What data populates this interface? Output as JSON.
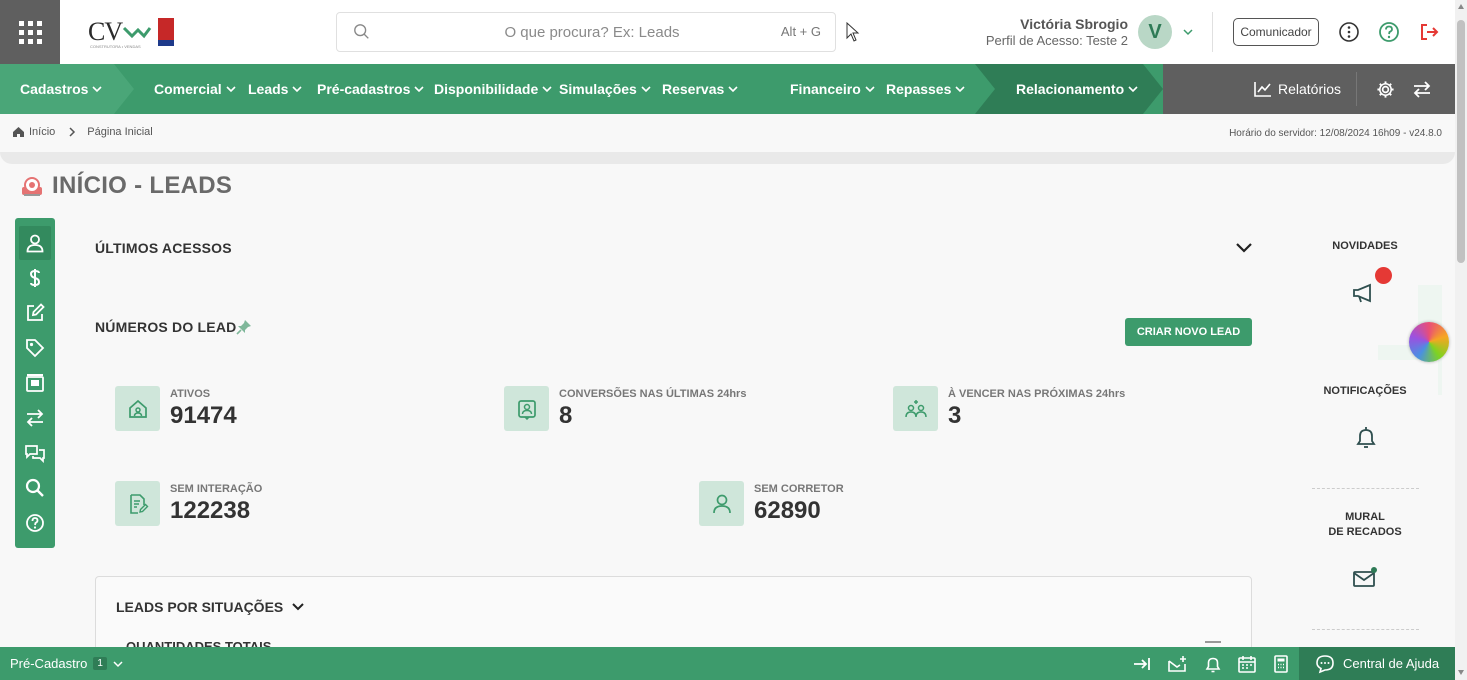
{
  "header": {
    "apps_icon": "apps-grid-icon",
    "logo_text": "CV",
    "logo_subtext": "CONSTRUTORA • VENDAS",
    "search_placeholder": "O que procura? Ex: Leads",
    "search_shortcut": "Alt + G",
    "user_name": "Victória Sbrogio",
    "user_profile": "Perfil de Acesso: Teste 2",
    "avatar_letter": "V",
    "comunicador_label": "Comunicador"
  },
  "nav": {
    "items": [
      {
        "label": "Cadastros"
      },
      {
        "label": "Comercial"
      },
      {
        "label": "Leads"
      },
      {
        "label": "Pré-cadastros"
      },
      {
        "label": "Disponibilidade"
      },
      {
        "label": "Simulações"
      },
      {
        "label": "Reservas"
      },
      {
        "label": "Financeiro"
      },
      {
        "label": "Repasses"
      },
      {
        "label": "Relacionamento"
      }
    ],
    "reports_label": "Relatórios"
  },
  "breadcrumb": {
    "home": "Início",
    "current": "Página Inicial"
  },
  "server_time": "Horário do servidor: 12/08/2024 16h09 - v24.8.0",
  "page_title": "INÍCIO - LEADS",
  "sections": {
    "ultimos_acessos": "ÚLTIMOS ACESSOS",
    "numeros_lead": "NÚMEROS DO LEAD",
    "criar_novo_lead": "CRIAR NOVO LEAD"
  },
  "stats": [
    {
      "label": "ATIVOS",
      "value": "91474",
      "icon": "house-icon"
    },
    {
      "label": "CONVERSÕES NAS ÚLTIMAS 24hrs",
      "value": "8",
      "icon": "contact-icon"
    },
    {
      "label": "À VENCER NAS PRÓXIMAS 24hrs",
      "value": "3",
      "icon": "group-icon"
    },
    {
      "label": "SEM INTERAÇÃO",
      "value": "122238",
      "icon": "document-edit-icon"
    },
    {
      "label": "SEM CORRETOR",
      "value": "62890",
      "icon": "person-icon"
    }
  ],
  "leads_panel": {
    "title": "LEADS POR SITUAÇÕES",
    "subtitle": "QUANTIDADES TOTAIS"
  },
  "right_column": {
    "novidades": "NOVIDADES",
    "notificacoes": "NOTIFICAÇÕES",
    "mural_line1": "MURAL",
    "mural_line2": "DE RECADOS"
  },
  "bottom": {
    "pre_cadastro_label": "Pré-Cadastro",
    "pre_cadastro_count": "1",
    "central_ajuda": "Central de Ajuda"
  },
  "colors": {
    "brand_green": "#3d9b6c",
    "dark_gray": "#5f5f5f",
    "stat_bg": "#cfe6da",
    "alert_red": "#e53935"
  }
}
